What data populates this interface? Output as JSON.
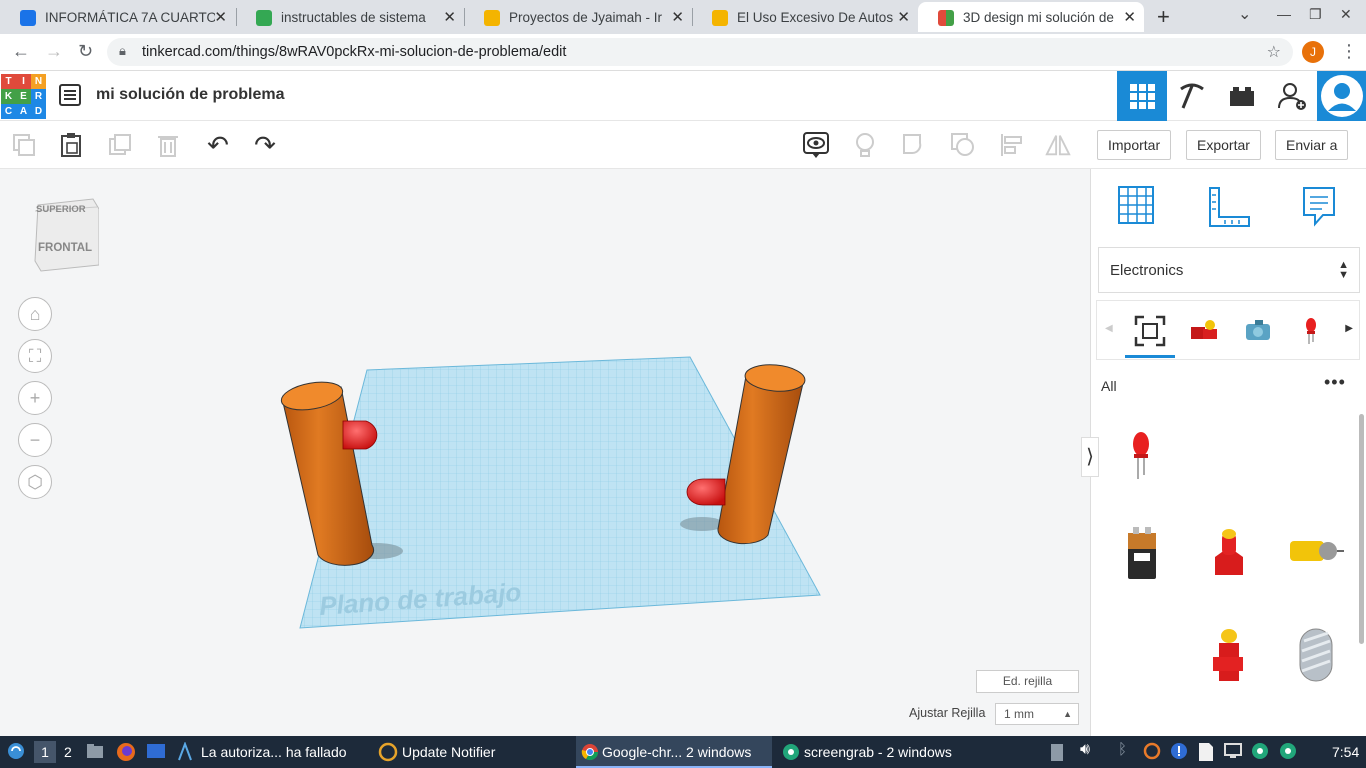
{
  "browser": {
    "tabs": [
      {
        "title": "INFORMÁTICA 7A CUARTO",
        "fav": "#1a73e8"
      },
      {
        "title": "instructables de sistema",
        "fav": "#34a853"
      },
      {
        "title": "Proyectos de Jyaimah - Ir",
        "fav": "#f4b400"
      },
      {
        "title": "El Uso Excesivo De Autos",
        "fav": "#f4b400"
      },
      {
        "title": "3D design mi solución de",
        "fav": "#e04a3b"
      }
    ],
    "url": "tinkercad.com/things/8wRAV0pckRx-mi-solucion-de-problema/edit",
    "profile_initial": "J"
  },
  "app": {
    "project_title": "mi solución de problema",
    "logo_letters": [
      "T",
      "I",
      "N",
      "K",
      "E",
      "R",
      "C",
      "A",
      "D"
    ]
  },
  "toolbar": {
    "import": "Importar",
    "export": "Exportar",
    "send": "Enviar a"
  },
  "viewport": {
    "viewcube_top": "SUPERIOR",
    "viewcube_front": "FRONTAL",
    "workplane_label": "Plano de trabajo",
    "edit_grid": "Ed. rejilla",
    "snap_grid_label": "Ajustar Rejilla",
    "snap_grid_value": "1 mm"
  },
  "panel": {
    "library": "Electronics",
    "filter": "All"
  },
  "taskbar": {
    "ws1": "1",
    "ws2": "2",
    "item_auth": "La autoriza... ha fallado",
    "item_update": "Update Notifier",
    "item_chrome": "Google-chr... 2 windows",
    "item_screengrab": "screengrab - 2 windows",
    "clock": "7:54"
  }
}
